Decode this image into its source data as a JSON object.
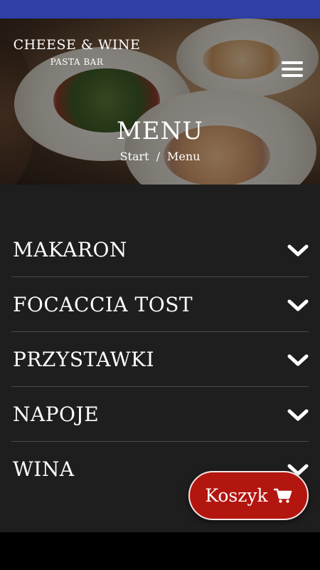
{
  "header": {
    "logo_title": "CHEESE & WINE",
    "logo_subtitle": "PASTA BAR",
    "menu_icon": "hamburger-icon"
  },
  "hero": {
    "title": "MENU",
    "breadcrumb": {
      "start": "Start",
      "separator": "/",
      "current": "Menu"
    }
  },
  "menu": {
    "items": [
      {
        "label": "MAKARON",
        "icon": "chevron-down-icon"
      },
      {
        "label": "FOCACCIA TOST",
        "icon": "chevron-down-icon"
      },
      {
        "label": "PRZYSTAWKI",
        "icon": "chevron-down-icon"
      },
      {
        "label": "NAPOJE",
        "icon": "chevron-down-icon"
      },
      {
        "label": "WINA",
        "icon": "chevron-down-icon"
      }
    ]
  },
  "cart": {
    "label": "Koszyk",
    "icon": "cart-icon"
  },
  "colors": {
    "status_bar": "#2f3fa6",
    "menu_background": "#1e1e1e",
    "cart_button": "#b3160f"
  }
}
